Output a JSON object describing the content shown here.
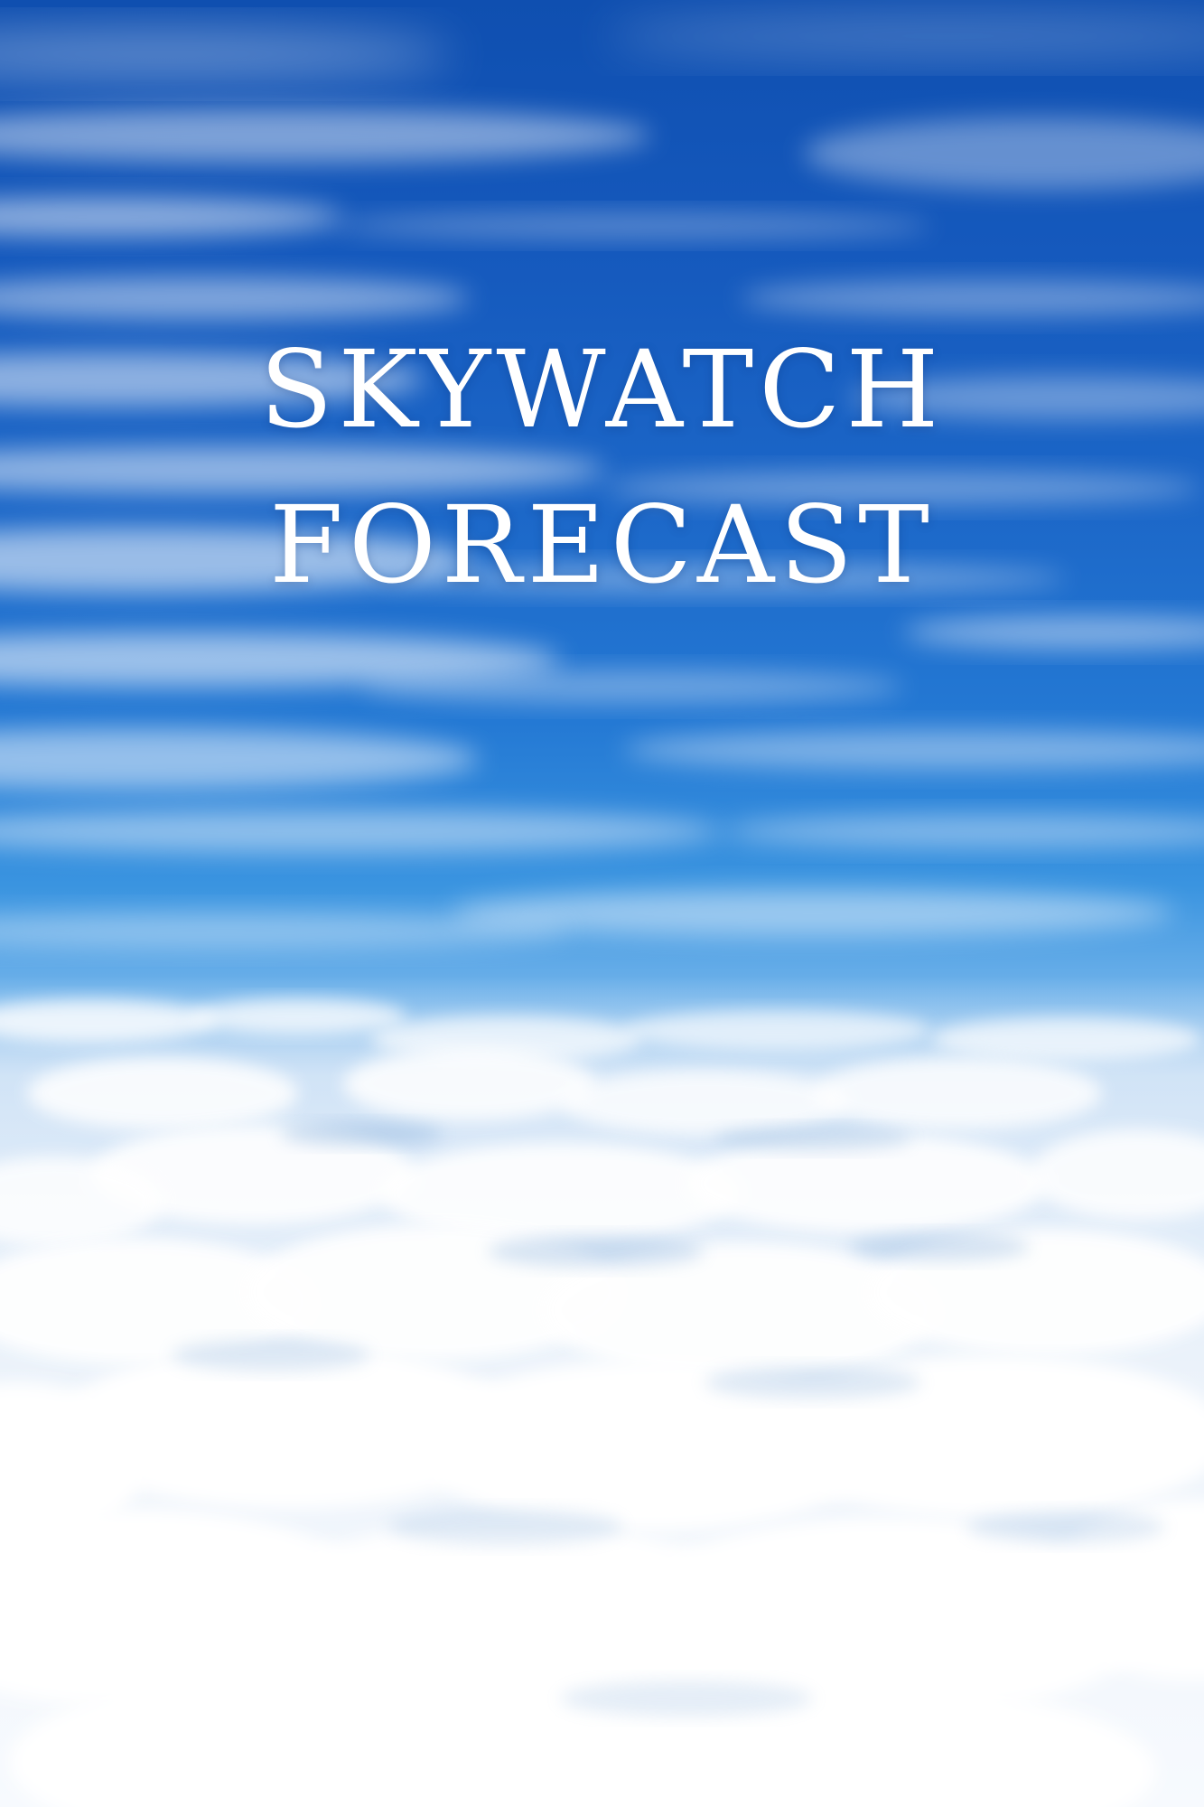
{
  "title": {
    "line1": "SKYWATCH",
    "line2": "FORECAST"
  },
  "colors": {
    "sky_deep": "#0f4fb0",
    "sky_mid": "#2479d4",
    "sky_horizon": "#6fb2ea",
    "cloud": "#ffffff",
    "text": "#ffffff"
  }
}
